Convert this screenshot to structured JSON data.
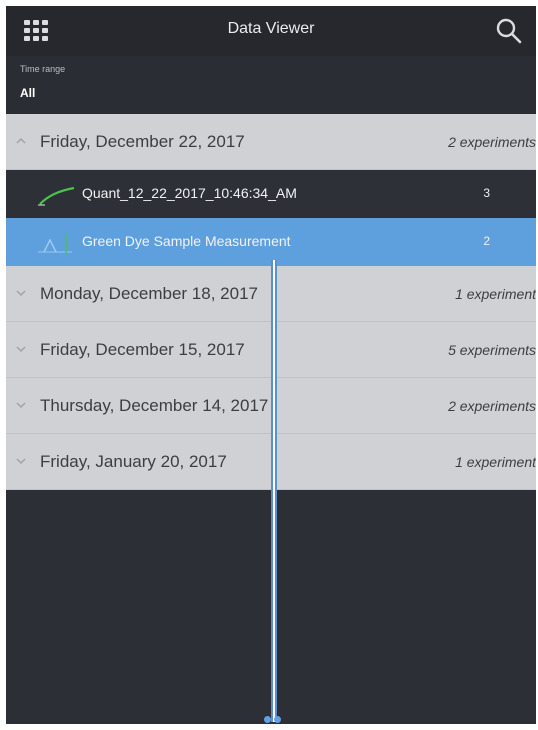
{
  "header": {
    "title": "Data Viewer",
    "menu_icon": "grid-menu-icon",
    "search_icon": "search-icon"
  },
  "filter": {
    "label": "Time range",
    "value": "All"
  },
  "groups": [
    {
      "date": "Friday, December 22, 2017",
      "count": "2 experiments",
      "expanded": true,
      "items": [
        {
          "name": "Quant_12_22_2017_10:46:34_AM",
          "count": "3",
          "icon": "curve-thumbnail-icon",
          "selected": false
        },
        {
          "name": "Green Dye Sample Measurement",
          "count": "2",
          "icon": "peak-thumbnail-icon",
          "selected": true
        }
      ]
    },
    {
      "date": "Monday, December 18, 2017",
      "count": "1 experiment",
      "expanded": false
    },
    {
      "date": "Friday, December 15, 2017",
      "count": "5 experiments",
      "expanded": false
    },
    {
      "date": "Thursday, December 14, 2017",
      "count": "2 experiments",
      "expanded": false
    },
    {
      "date": "Friday, January 20, 2017",
      "count": "1 experiment",
      "expanded": false
    }
  ],
  "colors": {
    "background": "#2c2f36",
    "header_row": "#cfd1d4",
    "selected_row": "#5ea0dd",
    "curve": "#4cc24a",
    "divider_accent": "#5b8fd4"
  }
}
